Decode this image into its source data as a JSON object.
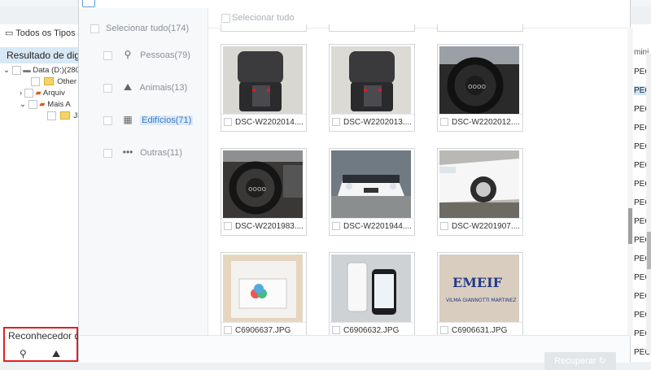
{
  "background": {
    "filter_label": "Todos os Tipos d",
    "results_header": "Resultado de digi",
    "tree": [
      {
        "label": "Data (D:)(280",
        "expanded": true
      },
      {
        "label": "Other I"
      },
      {
        "label": "Arquiv"
      },
      {
        "label": "Mais A"
      },
      {
        "label": "JP"
      }
    ],
    "recognizer_label": "Reconhecedor d",
    "right_column_label": "mini",
    "right_rows": [
      "PEC",
      "PEC",
      "PEC",
      "PEC",
      "PEC",
      "PEC",
      "PEC",
      "PEC",
      "PEC",
      "PEC",
      "PEC",
      "PEC",
      "PEC",
      "PEC",
      "PEC",
      "PEC"
    ]
  },
  "dialog": {
    "sidebar": {
      "select_all": "Selecionar tudo(174)",
      "categories": [
        {
          "label": "Pessoas(79)",
          "icon": "person-icon"
        },
        {
          "label": "Animais(13)",
          "icon": "animal-icon"
        },
        {
          "label": "Edifícios(71)",
          "icon": "building-icon",
          "active": true
        },
        {
          "label": "Outras(11)",
          "icon": "dots-icon"
        }
      ]
    },
    "content": {
      "select_all": "Selecionar tudo",
      "items": [
        {
          "name": "DSC-W2202014....",
          "kind": "seat-left"
        },
        {
          "name": "DSC-W2202013....",
          "kind": "seat-right"
        },
        {
          "name": "DSC-W2202012....",
          "kind": "wheel"
        },
        {
          "name": "DSC-W2201983....",
          "kind": "wheel2"
        },
        {
          "name": "DSC-W2201944....",
          "kind": "car-white"
        },
        {
          "name": "DSC-W2201907....",
          "kind": "car-side"
        },
        {
          "name": "C6906637.JPG",
          "kind": "phone-box"
        },
        {
          "name": "C6906632.JPG",
          "kind": "phone-white"
        },
        {
          "name": "C6906631.JPG",
          "kind": "emeif"
        }
      ]
    },
    "recover_label": "Recuperar"
  },
  "colors": {
    "accent": "#3a7cc4",
    "highlight": "#e02020"
  }
}
